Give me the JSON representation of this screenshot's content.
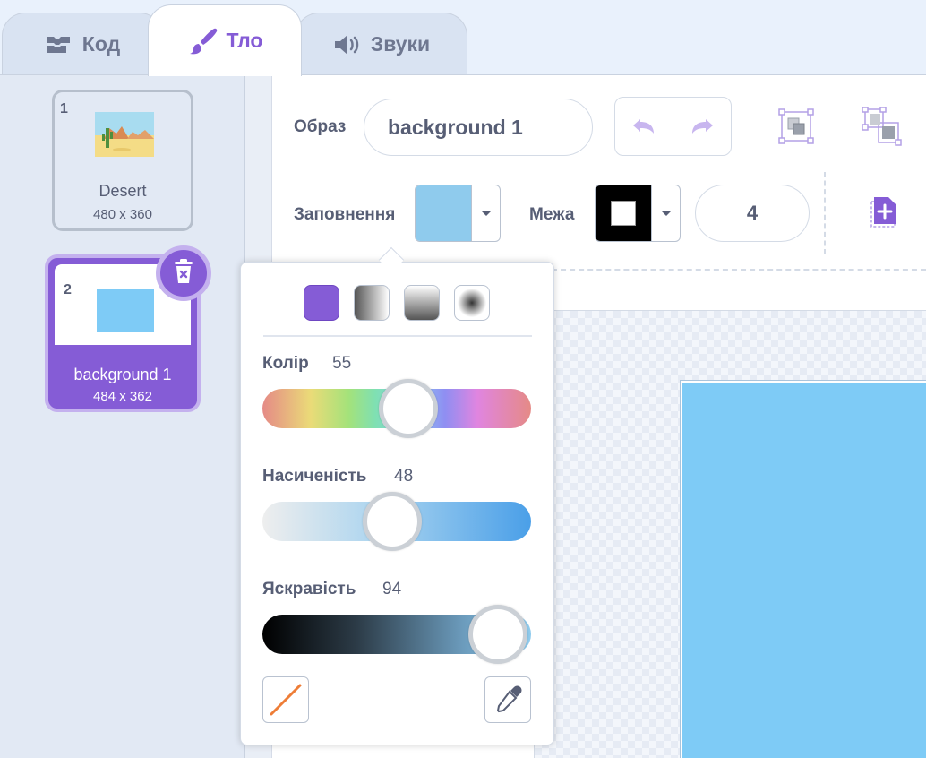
{
  "tabs": {
    "code": "Код",
    "backdrops": "Тло",
    "sounds": "Звуки"
  },
  "costumes": [
    {
      "number": "1",
      "name": "Desert",
      "size": "480 x 360"
    },
    {
      "number": "2",
      "name": "background 1",
      "size": "484 x 362",
      "selected": true
    }
  ],
  "editor": {
    "costume_label": "Образ",
    "costume_name": "background 1",
    "fill_label": "Заповнення",
    "outline_label": "Межа",
    "outline_width": "4",
    "fill_color": "#8fcbed",
    "outline_color": "#000000"
  },
  "color_picker": {
    "color_label": "Колір",
    "color_value": "55",
    "saturation_label": "Насиченість",
    "saturation_value": "48",
    "brightness_label": "Яскравість",
    "brightness_value": "94"
  },
  "colors": {
    "accent": "#855cd6",
    "canvas_fill": "#7ecbf6"
  },
  "icons": [
    "code-blocks-icon",
    "paintbrush-icon",
    "speaker-icon",
    "trash-icon",
    "undo-icon",
    "redo-icon",
    "group-icon",
    "ungroup-icon",
    "add-costume-icon",
    "no-fill-icon",
    "eyedropper-icon"
  ]
}
